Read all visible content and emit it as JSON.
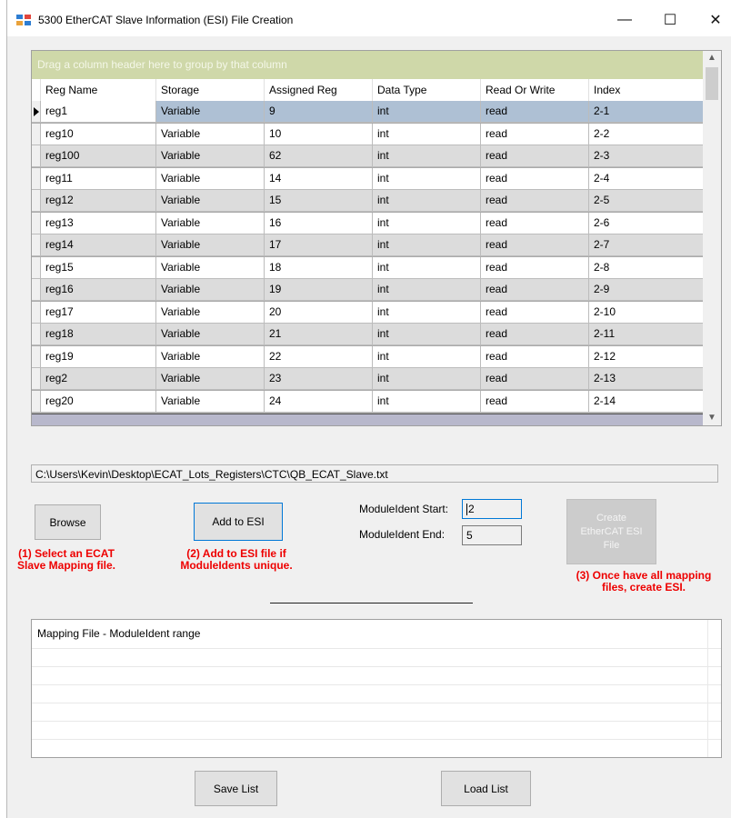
{
  "window": {
    "title": "5300 EtherCAT Slave Information (ESI) File Creation",
    "minimize": "—",
    "maximize": "☐",
    "close": "✕"
  },
  "grid": {
    "group_panel": "Drag a column header here to group by that column",
    "columns": [
      "Reg Name",
      "Storage",
      "Assigned Reg",
      "Data Type",
      "Read Or Write",
      "Index"
    ],
    "rows": [
      [
        "reg1",
        "Variable",
        "9",
        "int",
        "read",
        "2-1"
      ],
      [
        "reg10",
        "Variable",
        "10",
        "int",
        "read",
        "2-2"
      ],
      [
        "reg100",
        "Variable",
        "62",
        "int",
        "read",
        "2-3"
      ],
      [
        "reg11",
        "Variable",
        "14",
        "int",
        "read",
        "2-4"
      ],
      [
        "reg12",
        "Variable",
        "15",
        "int",
        "read",
        "2-5"
      ],
      [
        "reg13",
        "Variable",
        "16",
        "int",
        "read",
        "2-6"
      ],
      [
        "reg14",
        "Variable",
        "17",
        "int",
        "read",
        "2-7"
      ],
      [
        "reg15",
        "Variable",
        "18",
        "int",
        "read",
        "2-8"
      ],
      [
        "reg16",
        "Variable",
        "19",
        "int",
        "read",
        "2-9"
      ],
      [
        "reg17",
        "Variable",
        "20",
        "int",
        "read",
        "2-10"
      ],
      [
        "reg18",
        "Variable",
        "21",
        "int",
        "read",
        "2-11"
      ],
      [
        "reg19",
        "Variable",
        "22",
        "int",
        "read",
        "2-12"
      ],
      [
        "reg2",
        "Variable",
        "23",
        "int",
        "read",
        "2-13"
      ],
      [
        "reg20",
        "Variable",
        "24",
        "int",
        "read",
        "2-14"
      ]
    ]
  },
  "file_path": "C:\\Users\\Kevin\\Desktop\\ECAT_Lots_Registers\\CTC\\QB_ECAT_Slave.txt",
  "buttons": {
    "browse": "Browse",
    "add_to_esi": "Add to ESI",
    "create_line1": "Create",
    "create_line2": "EtherCAT ESI",
    "create_line3": "File",
    "save_list": "Save List",
    "load_list": "Load List"
  },
  "module_ident": {
    "start_label": "ModuleIdent Start:",
    "start_value": "2",
    "end_label": "ModuleIdent End:",
    "end_value": "5"
  },
  "hints": {
    "step1_line1": "(1) Select an ECAT",
    "step1_line2": "Slave Mapping file.",
    "step2_line1": "(2) Add to ESI file if",
    "step2_line2": "ModuleIdents unique.",
    "step3_line1": "(3) Once have all mapping",
    "step3_line2": "files, create ESI."
  },
  "mapping_list": {
    "header": "Mapping File - ModuleIdent range"
  },
  "colors": {
    "group_panel": "#cfd8a9",
    "selected_row": "#aec0d4",
    "hint_red": "#ee0000",
    "focus_blue": "#0078d7"
  }
}
